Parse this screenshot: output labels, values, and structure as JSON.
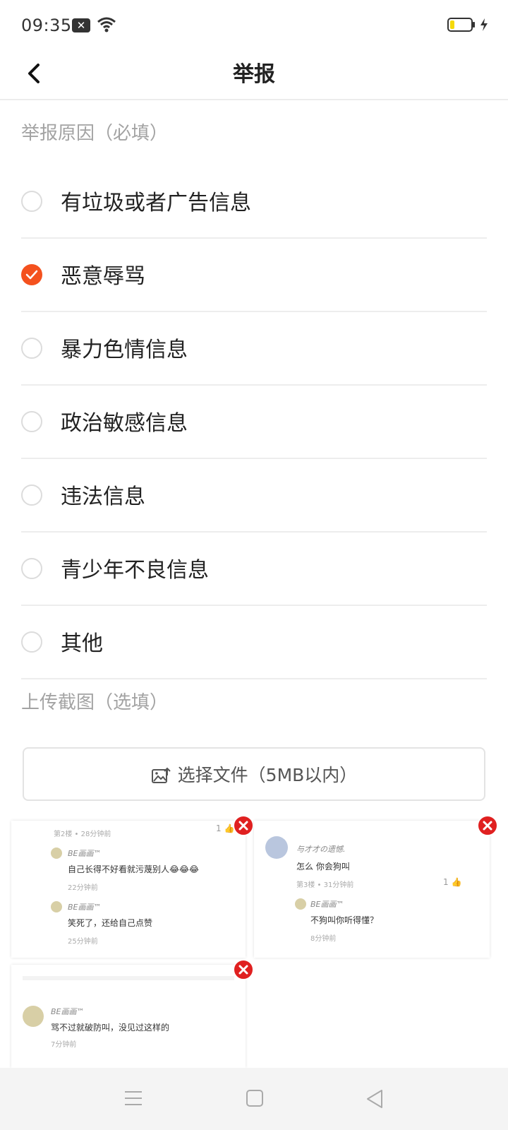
{
  "status_bar": {
    "time": "09:35"
  },
  "header": {
    "title": "举报"
  },
  "reasons": {
    "label": "举报原因（必填）",
    "items": [
      {
        "label": "有垃圾或者广告信息",
        "checked": false
      },
      {
        "label": "恶意辱骂",
        "checked": true
      },
      {
        "label": "暴力色情信息",
        "checked": false
      },
      {
        "label": "政治敏感信息",
        "checked": false
      },
      {
        "label": "违法信息",
        "checked": false
      },
      {
        "label": "青少年不良信息",
        "checked": false
      },
      {
        "label": "其他",
        "checked": false
      }
    ]
  },
  "upload": {
    "label": "上传截图（选填）",
    "button_label": "选择文件（5MB以内）"
  },
  "screenshots": {
    "s1": {
      "top_meta": "第2楼 • 28分钟前",
      "c1_name": "BE画画™",
      "c1_text": "自己长得不好看就污蔑别人😂😂😂",
      "c1_meta": "22分钟前",
      "c2_name": "BE画画™",
      "c2_text": "笑死了，还给自己点赞",
      "c2_meta": "25分钟前"
    },
    "s2": {
      "name": "与才才の遗憾.",
      "text": "怎么 你会狗叫",
      "meta": "第3楼 • 31分钟前",
      "reply_name": "BE画画™",
      "reply_text": "不狗叫你听得懂？",
      "reply_meta": "8分钟前"
    },
    "s3": {
      "name": "BE画画™",
      "text": "骂不过就破防叫，没见过这样的",
      "meta": "7分钟前"
    }
  },
  "colors": {
    "accent": "#f4511e",
    "close": "#e02020",
    "divider": "#ededed"
  },
  "icons": [
    "notification-icon",
    "wifi-icon",
    "battery-icon",
    "charging-icon",
    "back-arrow-icon",
    "check-icon",
    "image-upload-icon",
    "close-icon",
    "thumb-up-icon",
    "menu-icon",
    "home-square-icon",
    "back-triangle-icon"
  ]
}
